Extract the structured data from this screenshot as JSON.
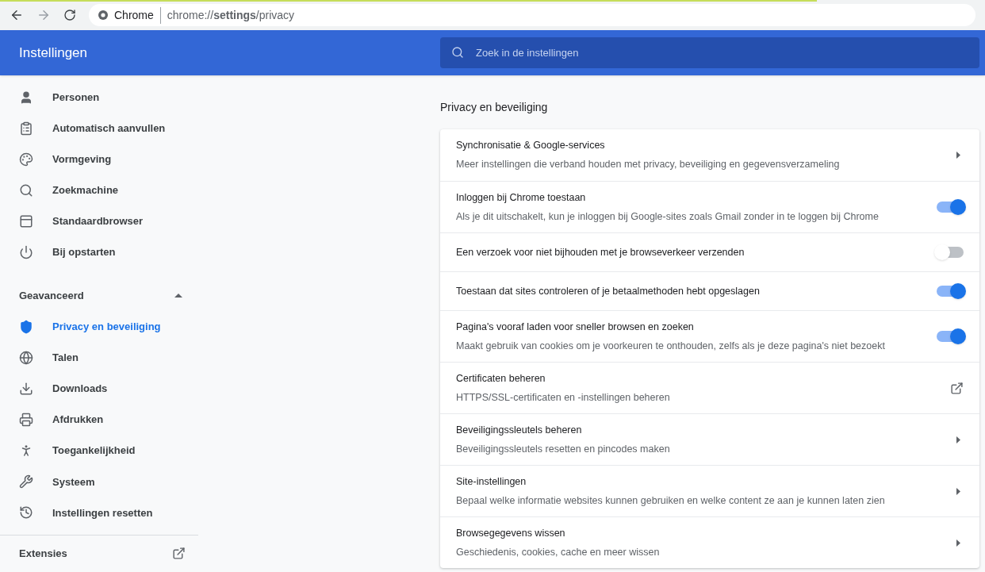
{
  "browser": {
    "site_label": "Chrome",
    "url": "chrome://**settings**/privacy",
    "forward_disabled": true
  },
  "header": {
    "title": "Instellingen",
    "search": {
      "placeholder": "Zoek in de instellingen"
    }
  },
  "sidebar": {
    "items": [
      {
        "label": "Personen",
        "selected": false
      },
      {
        "label": "Automatisch aanvullen",
        "selected": false
      },
      {
        "label": "Vormgeving",
        "selected": false
      },
      {
        "label": "Zoekmachine",
        "selected": false
      },
      {
        "label": "Standaardbrowser",
        "selected": false
      },
      {
        "label": "Bij opstarten",
        "selected": false
      }
    ],
    "advanced": {
      "label": "Geavanceerd",
      "expanded": true,
      "items": [
        {
          "label": "Privacy en beveiliging",
          "selected": true
        },
        {
          "label": "Talen",
          "selected": false
        },
        {
          "label": "Downloads",
          "selected": false
        },
        {
          "label": "Afdrukken",
          "selected": false
        },
        {
          "label": "Toegankelijkheid",
          "selected": false
        },
        {
          "label": "Systeem",
          "selected": false
        },
        {
          "label": "Instellingen resetten",
          "selected": false
        }
      ]
    },
    "extensions": {
      "label": "Extensies"
    }
  },
  "section": {
    "title": "Privacy en beveiliging",
    "rows": [
      {
        "kind": "link",
        "title": "Synchronisatie & Google-services",
        "subtitle": "Meer instellingen die verband houden met privacy, beveiliging en gegevensverzameling"
      },
      {
        "kind": "toggle",
        "title": "Inloggen bij Chrome toestaan",
        "subtitle": "Als je dit uitschakelt, kun je inloggen bij Google-sites zoals Gmail zonder in te loggen bij Chrome",
        "on": true
      },
      {
        "kind": "toggle",
        "title": "Een verzoek voor niet bijhouden met je browseverkeer verzenden",
        "on": false
      },
      {
        "kind": "toggle",
        "title": "Toestaan dat sites controleren of je betaalmethoden hebt opgeslagen",
        "on": true
      },
      {
        "kind": "toggle",
        "title": "Pagina's vooraf laden voor sneller browsen en zoeken",
        "subtitle": "Maakt gebruik van cookies om je voorkeuren te onthouden, zelfs als je deze pagina's niet bezoekt",
        "on": true
      },
      {
        "kind": "external",
        "title": "Certificaten beheren",
        "subtitle": "HTTPS/SSL-certificaten en -instellingen beheren"
      },
      {
        "kind": "link",
        "title": "Beveiligingssleutels beheren",
        "subtitle": "Beveiligingssleutels resetten en pincodes maken"
      },
      {
        "kind": "link",
        "title": "Site-instellingen",
        "subtitle": "Bepaal welke informatie websites kunnen gebruiken en welke content ze aan je kunnen laten zien"
      },
      {
        "kind": "link",
        "title": "Browsegegevens wissen",
        "subtitle": "Geschiedenis, cookies, cache en meer wissen"
      }
    ]
  }
}
